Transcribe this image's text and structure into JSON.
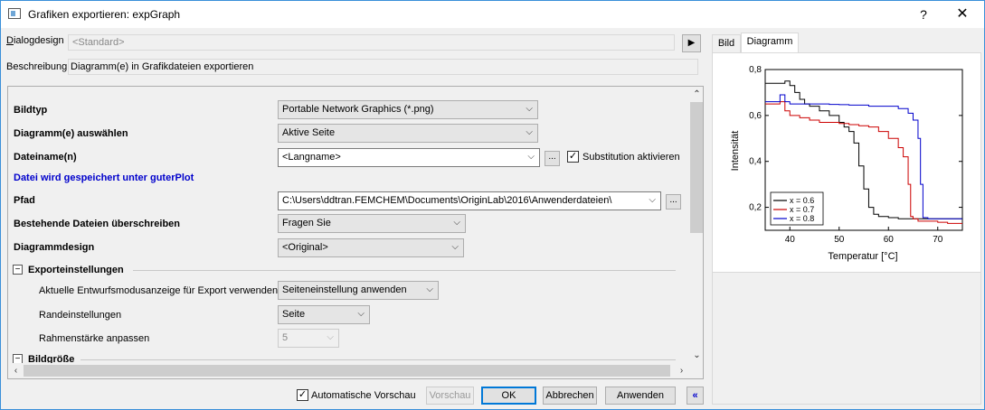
{
  "window": {
    "title": "Grafiken exportieren: expGraph",
    "help": "?",
    "close": "✕"
  },
  "header": {
    "dialogdesign_label_prefix": "D",
    "dialogdesign_label_rest": "ialogdesign",
    "dialogdesign_value": "<Standard>",
    "arrow": "▶",
    "beschreibung_label": "Beschreibung",
    "beschreibung_value": "Diagramm(e) in Grafikdateien exportieren"
  },
  "form": {
    "bildtyp": {
      "label": "Bildtyp",
      "value": "Portable Network Graphics (*.png)"
    },
    "diagramm_auswaehlen": {
      "label": "Diagramm(e) auswählen",
      "value": "Aktive Seite"
    },
    "dateiname": {
      "label": "Dateiname(n)",
      "value": "<Langname>",
      "dots": "...",
      "substitution_label": "Substitution aktivieren",
      "substitution_checked": "✓"
    },
    "save_info": "Datei wird gespeichert unter guterPlot",
    "pfad": {
      "label": "Pfad",
      "value": "C:\\Users\\ddtran.FEMCHEM\\Documents\\OriginLab\\2016\\Anwenderdateien\\",
      "dots": "..."
    },
    "ueberschreiben": {
      "label": "Bestehende Dateien überschreiben",
      "value": "Fragen Sie"
    },
    "diagrammdesign": {
      "label": "Diagrammdesign",
      "value": "<Original>"
    },
    "exporteinstellungen": {
      "toggle": "−",
      "label": "Exporteinstellungen",
      "entwurfsmodus": {
        "label": "Aktuelle Entwurfsmodusanzeige für Export verwenden",
        "value": "Seiteneinstellung anwenden"
      },
      "randeinstellungen": {
        "label": "Randeinstellungen",
        "value": "Seite"
      },
      "rahmenstaerke": {
        "label": "Rahmenstärke anpassen",
        "value": "5"
      }
    },
    "bildgroesse": {
      "toggle": "−",
      "label": "Bildgröße"
    }
  },
  "footer": {
    "auto_preview_label": "Automatische Vorschau",
    "auto_preview_checked": "✓",
    "vorschau": "Vorschau",
    "ok": "OK",
    "abbrechen": "Abbrechen",
    "anwenden": "Anwenden",
    "collapse": "«"
  },
  "tabs": [
    {
      "label": "Bild"
    },
    {
      "label": "Diagramm"
    }
  ],
  "chart_data": {
    "type": "line",
    "xlabel": "Temperatur [°C]",
    "ylabel": "Intensität",
    "xlim": [
      35,
      75
    ],
    "ylim": [
      0.1,
      0.8
    ],
    "xticks": [
      "40",
      "50",
      "60",
      "70"
    ],
    "yticks": [
      "0,2",
      "0,4",
      "0,6",
      "0,8"
    ],
    "legend_position": "bottom-left",
    "series": [
      {
        "name": "x = 0.6",
        "color": "#000000",
        "x": [
          35,
          37,
          39,
          40,
          41,
          42,
          43,
          44,
          46,
          48,
          50,
          51,
          52,
          53,
          54,
          55,
          56,
          57,
          58,
          60,
          62,
          64,
          66,
          68,
          70,
          72,
          75
        ],
        "y": [
          0.74,
          0.74,
          0.75,
          0.73,
          0.7,
          0.67,
          0.65,
          0.64,
          0.62,
          0.6,
          0.57,
          0.55,
          0.53,
          0.48,
          0.38,
          0.28,
          0.2,
          0.17,
          0.16,
          0.155,
          0.15,
          0.15,
          0.15,
          0.15,
          0.15,
          0.15,
          0.15
        ]
      },
      {
        "name": "x = 0.7",
        "color": "#cc0000",
        "x": [
          35,
          37,
          38,
          39,
          40,
          42,
          44,
          46,
          48,
          50,
          52,
          54,
          56,
          58,
          60,
          62,
          63,
          64,
          64.5,
          65,
          66,
          68,
          70,
          72,
          75
        ],
        "y": [
          0.65,
          0.65,
          0.66,
          0.62,
          0.6,
          0.59,
          0.58,
          0.57,
          0.57,
          0.565,
          0.56,
          0.555,
          0.55,
          0.53,
          0.5,
          0.46,
          0.42,
          0.3,
          0.16,
          0.15,
          0.14,
          0.14,
          0.135,
          0.13,
          0.13
        ]
      },
      {
        "name": "x = 0.8",
        "color": "#0000cc",
        "x": [
          35,
          37,
          38,
          39,
          40,
          42,
          44,
          46,
          48,
          50,
          52,
          54,
          56,
          58,
          60,
          62,
          64,
          65,
          66,
          66.5,
          67,
          68,
          70,
          72,
          75
        ],
        "y": [
          0.66,
          0.66,
          0.69,
          0.66,
          0.65,
          0.65,
          0.65,
          0.65,
          0.648,
          0.647,
          0.645,
          0.645,
          0.64,
          0.64,
          0.64,
          0.63,
          0.61,
          0.58,
          0.5,
          0.3,
          0.155,
          0.15,
          0.15,
          0.15,
          0.15
        ]
      }
    ]
  }
}
